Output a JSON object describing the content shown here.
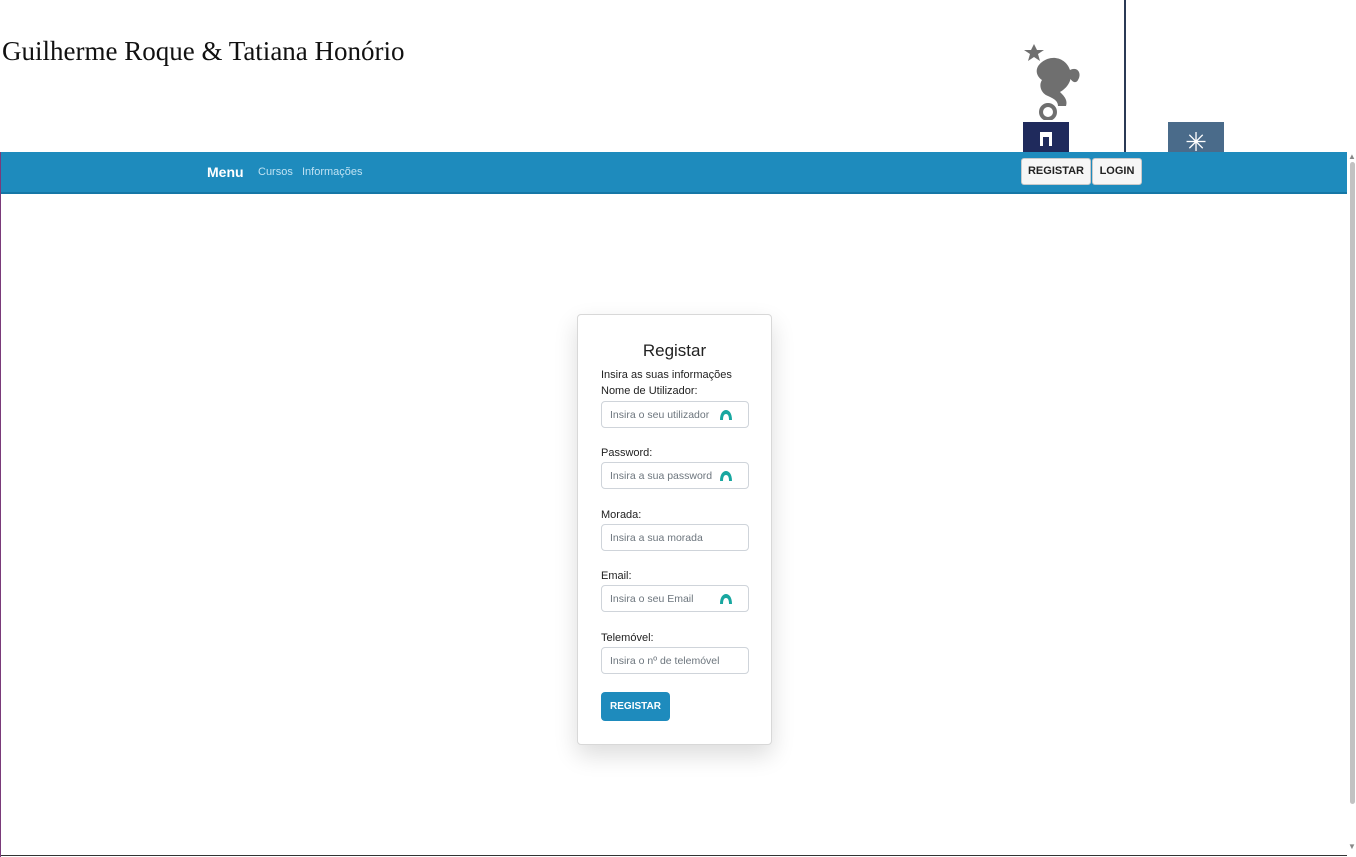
{
  "header": {
    "site_title": "Guilherme Roque & Tatiana Honório"
  },
  "navbar": {
    "brand": "Menu",
    "links": [
      "Cursos",
      "Informações"
    ],
    "register_button": "REGISTAR",
    "login_button": "LOGIN",
    "color": "#1e8bbd"
  },
  "form": {
    "title": "Registar",
    "subtitle": "Insira as suas informações",
    "fields": [
      {
        "label": "Nome de Utilizador:",
        "placeholder": "Insira o seu utilizador",
        "icon": "password-manager-icon"
      },
      {
        "label": "Password:",
        "placeholder": "Insira a sua password",
        "icon": "password-manager-icon"
      },
      {
        "label": "Morada:",
        "placeholder": "Insira a sua morada"
      },
      {
        "label": "Email:",
        "placeholder": "Insira o seu Email",
        "icon": "password-manager-icon"
      },
      {
        "label": "Telemóvel:",
        "placeholder": "Insira o nº de telemóvel"
      }
    ],
    "submit_label": "REGISTAR"
  }
}
